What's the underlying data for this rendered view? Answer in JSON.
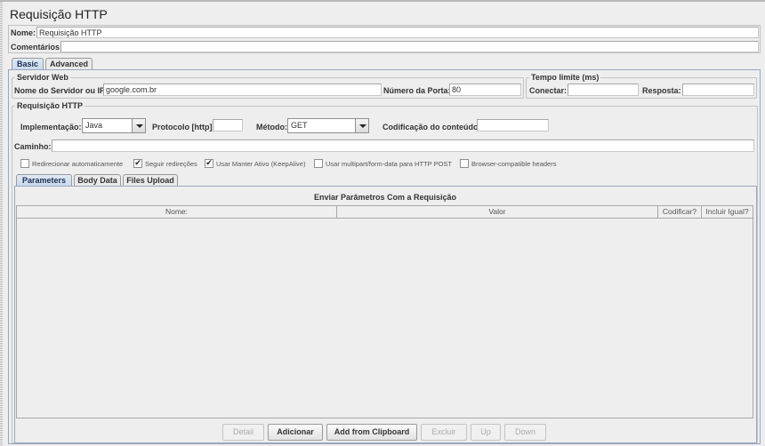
{
  "title": "Requisição HTTP",
  "name_label": "Nome:",
  "name_value": "Requisição HTTP",
  "comments_label": "Comentários:",
  "comments_value": "",
  "main_tabs": [
    {
      "label": "Basic",
      "active": true
    },
    {
      "label": "Advanced",
      "active": false
    }
  ],
  "web_server": {
    "title": "Servidor Web",
    "server_label": "Nome do Servidor ou IP:",
    "server_value": "google.com.br",
    "port_label": "Número da Porta:",
    "port_value": "80"
  },
  "timeout": {
    "title": "Tempo limite (ms)",
    "connect_label": "Conectar:",
    "connect_value": "",
    "response_label": "Resposta:",
    "response_value": ""
  },
  "http_request": {
    "title": "Requisição HTTP",
    "impl_label": "Implementação:",
    "impl_value": "Java",
    "protocol_label": "Protocolo [http]:",
    "protocol_value": "",
    "method_label": "Método:",
    "method_value": "GET",
    "encoding_label": "Codificação do conteúdo:",
    "encoding_value": "",
    "path_label": "Caminho:",
    "path_value": ""
  },
  "checkboxes": [
    {
      "label": "Redirecionar automaticamente",
      "checked": false
    },
    {
      "label": "Seguir redireções",
      "checked": true
    },
    {
      "label": "Usar Manter Ativo (KeepAlive)",
      "checked": true
    },
    {
      "label": "Usar multipart/form-data para HTTP POST",
      "checked": false
    },
    {
      "label": "Browser-compatible headers",
      "checked": false
    }
  ],
  "sub_tabs": [
    {
      "label": "Parameters",
      "active": true
    },
    {
      "label": "Body Data",
      "active": false
    },
    {
      "label": "Files Upload",
      "active": false
    }
  ],
  "params_table": {
    "title": "Enviar Parâmetros Com a Requisição",
    "columns": [
      "Nome:",
      "Valor",
      "Codificar?",
      "Incluir Igual?"
    ],
    "rows": []
  },
  "buttons": [
    {
      "label": "Detail",
      "enabled": false
    },
    {
      "label": "Adicionar",
      "enabled": true
    },
    {
      "label": "Add from Clipboard",
      "enabled": true
    },
    {
      "label": "Excluir",
      "enabled": false
    },
    {
      "label": "Up",
      "enabled": false
    },
    {
      "label": "Down",
      "enabled": false
    }
  ],
  "check_mark": "✔"
}
